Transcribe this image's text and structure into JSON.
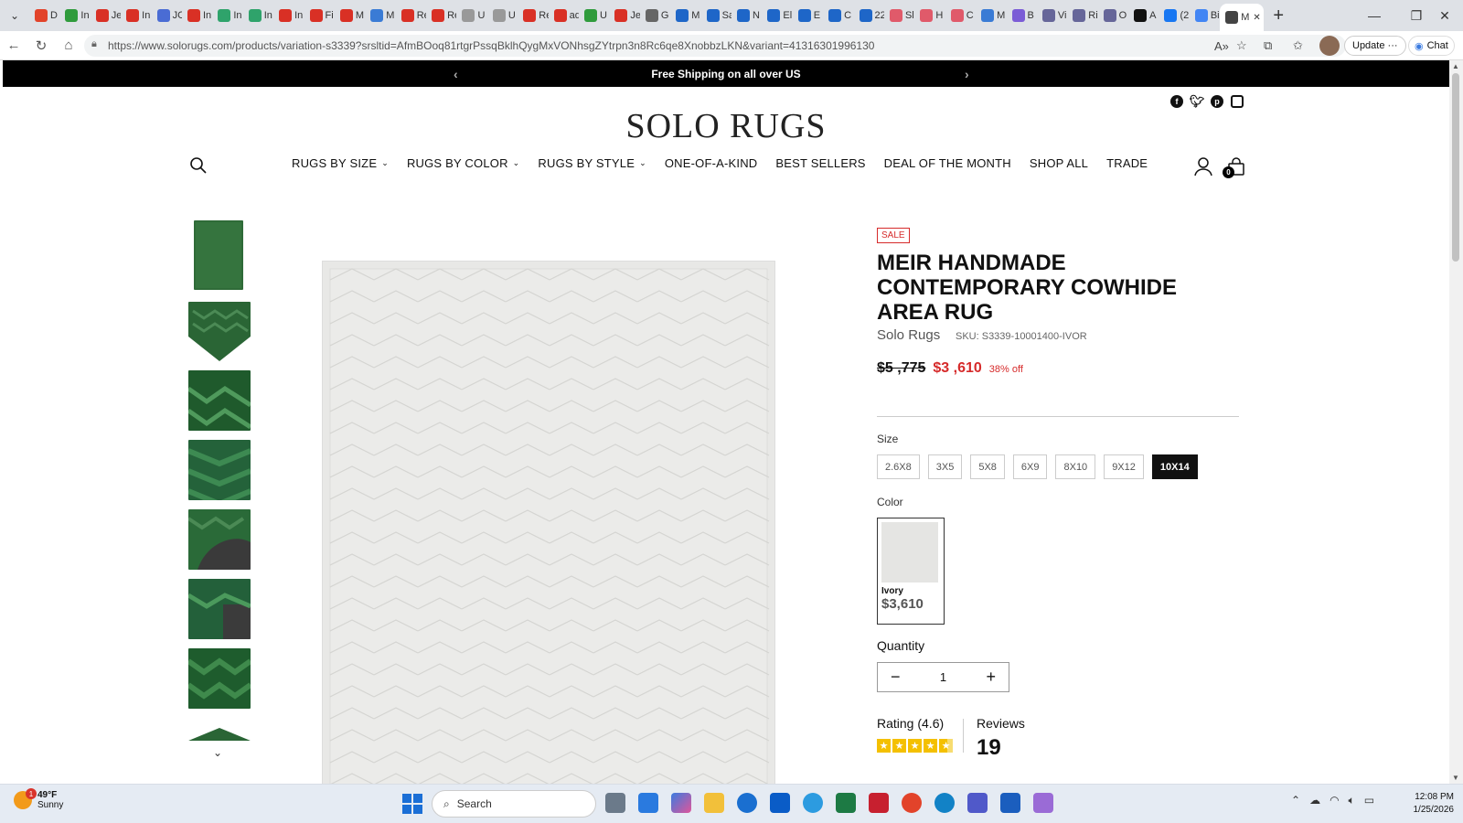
{
  "browser": {
    "tabs": [
      {
        "label": "D",
        "color": "#e2432a"
      },
      {
        "label": "In",
        "color": "#2f9b3c"
      },
      {
        "label": "Je",
        "color": "#d93025"
      },
      {
        "label": "In",
        "color": "#d93025"
      },
      {
        "label": "JC",
        "color": "#4a6cd4"
      },
      {
        "label": "In",
        "color": "#d93025"
      },
      {
        "label": "In",
        "color": "#2fa36b"
      },
      {
        "label": "In",
        "color": "#2fa36b"
      },
      {
        "label": "In",
        "color": "#d93025"
      },
      {
        "label": "Fi",
        "color": "#d93025"
      },
      {
        "label": "M",
        "color": "#d93025"
      },
      {
        "label": "M",
        "color": "#3a7bd5"
      },
      {
        "label": "Re",
        "color": "#d93025"
      },
      {
        "label": "Re",
        "color": "#d93025"
      },
      {
        "label": "U",
        "color": "#999999"
      },
      {
        "label": "U",
        "color": "#999999"
      },
      {
        "label": "Re",
        "color": "#d93025"
      },
      {
        "label": "ad",
        "color": "#d93025"
      },
      {
        "label": "U",
        "color": "#2f9b3c"
      },
      {
        "label": "Je",
        "color": "#d93025"
      },
      {
        "label": "G",
        "color": "#666666"
      },
      {
        "label": "M",
        "color": "#1e66c8"
      },
      {
        "label": "Sa",
        "color": "#1e66c8"
      },
      {
        "label": "N",
        "color": "#1e66c8"
      },
      {
        "label": "El",
        "color": "#1e66c8"
      },
      {
        "label": "E",
        "color": "#1e66c8"
      },
      {
        "label": "C",
        "color": "#1e66c8"
      },
      {
        "label": "22",
        "color": "#1e66c8"
      },
      {
        "label": "Sl",
        "color": "#e05a6a"
      },
      {
        "label": "H",
        "color": "#e05a6a"
      },
      {
        "label": "C",
        "color": "#e05a6a"
      },
      {
        "label": "M",
        "color": "#3a7bd5"
      },
      {
        "label": "B",
        "color": "#7b5cd6"
      },
      {
        "label": "Vi",
        "color": "#666699"
      },
      {
        "label": "Ri",
        "color": "#666699"
      },
      {
        "label": "O",
        "color": "#666699"
      },
      {
        "label": "A",
        "color": "#111111"
      },
      {
        "label": "(2",
        "color": "#1877f2"
      },
      {
        "label": "Bi",
        "color": "#4285f4"
      },
      {
        "label": "M",
        "color": "#444444"
      }
    ],
    "new_tab": "+",
    "url": "https://www.solorugs.com/products/variation-s3339?srsltid=AfmBOoq81rtgrPssqBklhQygMxVONhsgZYtrpn3n8Rc6qe8XnobbzLKN&variant=41316301996130",
    "update_label": "Update",
    "chat_label": "Chat"
  },
  "promo": {
    "text": "Free Shipping on all over US"
  },
  "logo": "SOLO RUGS",
  "nav": {
    "links": [
      {
        "label": "RUGS BY SIZE",
        "dropdown": true
      },
      {
        "label": "RUGS BY COLOR",
        "dropdown": true
      },
      {
        "label": "RUGS BY STYLE",
        "dropdown": true
      },
      {
        "label": "ONE-OF-A-KIND",
        "dropdown": false
      },
      {
        "label": "BEST SELLERS",
        "dropdown": false
      },
      {
        "label": "DEAL OF THE MONTH",
        "dropdown": false
      },
      {
        "label": "SHOP ALL",
        "dropdown": false
      },
      {
        "label": "TRADE",
        "dropdown": false
      }
    ],
    "cart_count": "0"
  },
  "social": [
    "facebook-icon",
    "twitter-icon",
    "pinterest-icon",
    "instagram-icon"
  ],
  "product": {
    "badge": "SALE",
    "title": "MEIR HANDMADE CONTEMPORARY COWHIDE AREA RUG",
    "brand": "Solo Rugs",
    "sku": "SKU: S3339-10001400-IVOR",
    "price_was": "$5 ,775",
    "price_now": "$3 ,610",
    "discount": "38% off",
    "size_label": "Size",
    "sizes": [
      "2.6X8",
      "3X5",
      "5X8",
      "6X9",
      "8X10",
      "9X12",
      "10X14"
    ],
    "selected_size": "10X14",
    "color_label": "Color",
    "color": {
      "name": "Ivory",
      "price": "$3,610"
    },
    "quantity_label": "Quantity",
    "quantity": "1",
    "rating_label": "Rating (4.6)",
    "rating_stars": 4.6,
    "reviews_label": "Reviews",
    "reviews_count": "19"
  },
  "colors": {
    "accent_red": "#d62b2b",
    "thumb_green": "#2e6b3a",
    "rug_ivory": "#e7e7e5"
  },
  "taskbar": {
    "weather_temp": "49°F",
    "weather_desc": "Sunny",
    "weather_badge": "1",
    "search_placeholder": "Search",
    "time": "12:08 PM",
    "date": "1/25/2026"
  }
}
